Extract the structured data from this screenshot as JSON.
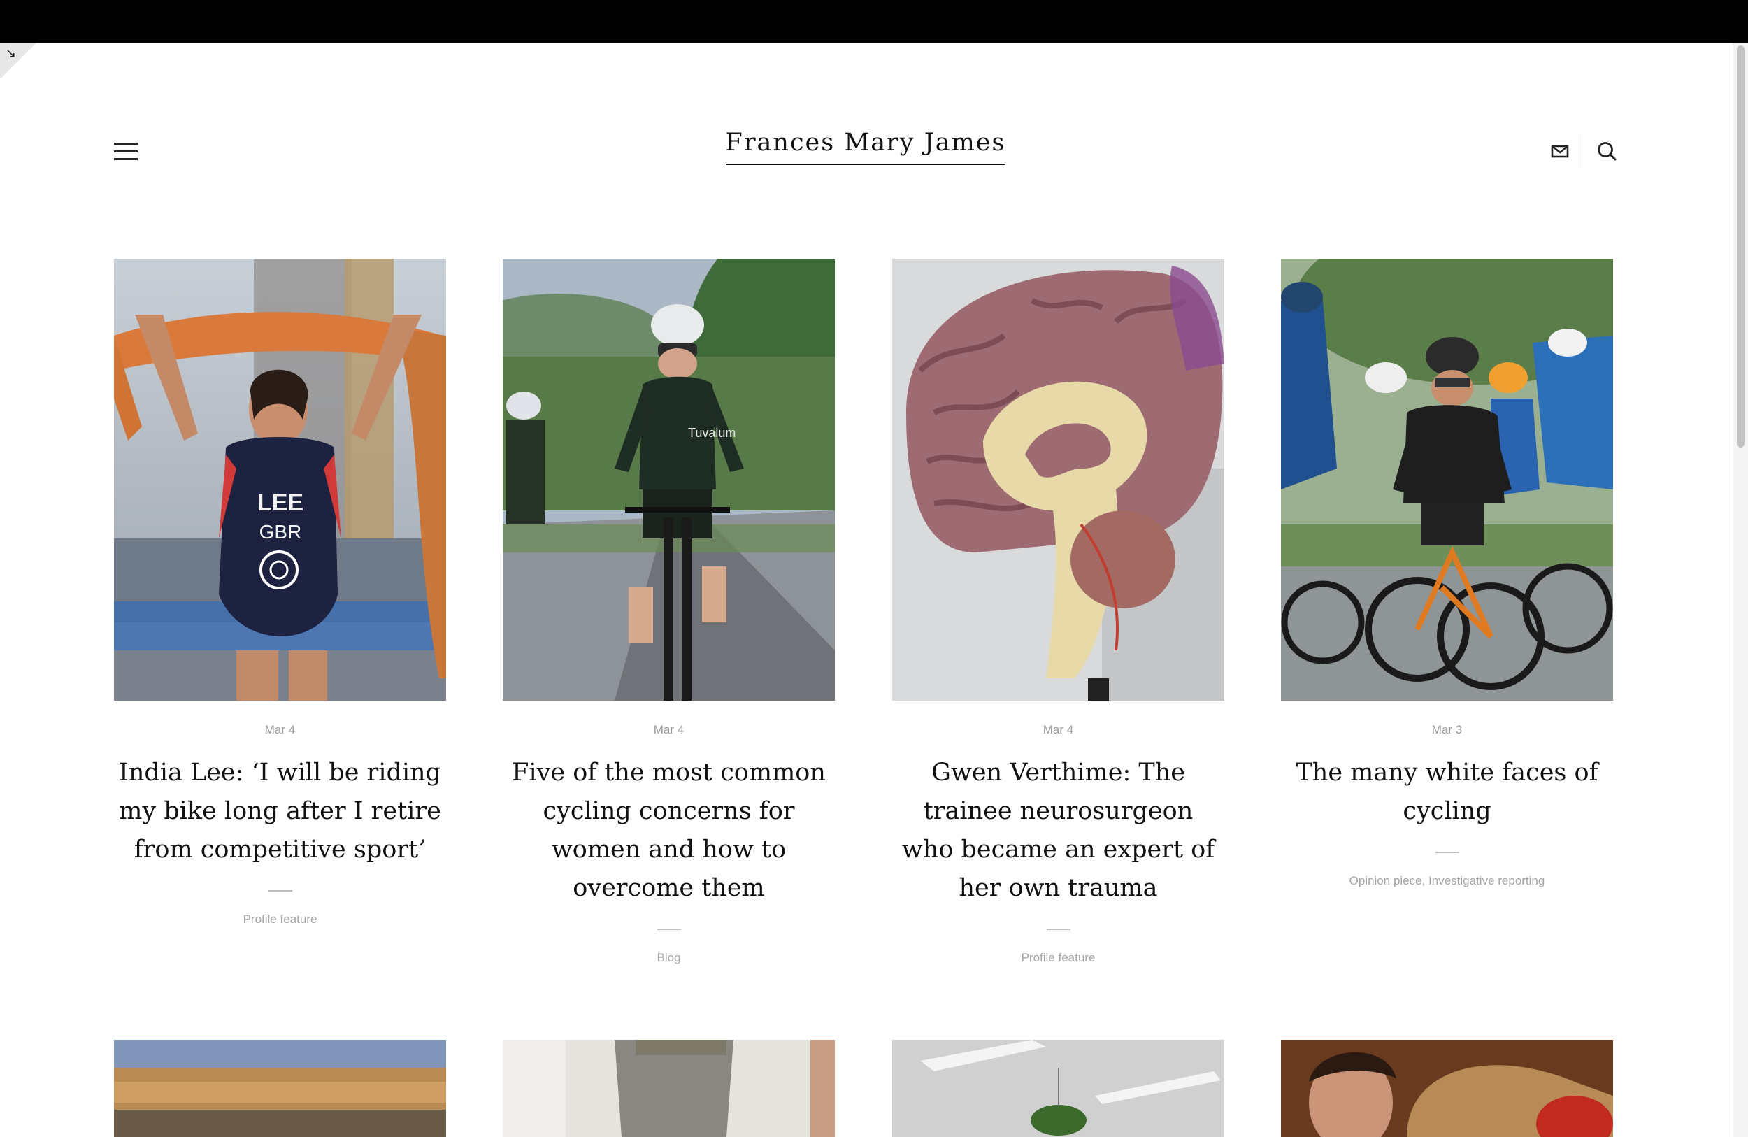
{
  "site": {
    "title": "Frances Mary James"
  },
  "header": {
    "menu_icon": "hamburger-menu-icon",
    "email_icon": "envelope-icon",
    "search_icon": "search-icon"
  },
  "posts": [
    {
      "date": "Mar 4",
      "title": "India Lee: ‘I will be riding my bike long after I retire from competitive sport’",
      "category": "Profile feature",
      "image": "triathlete-finish-line-photo"
    },
    {
      "date": "Mar 4",
      "title": "Five of the most common cycling concerns for women and how to overcome them",
      "category": "Blog",
      "image": "woman-cyclist-photo"
    },
    {
      "date": "Mar 4",
      "title": "Gwen Verthime: The trainee neurosurgeon who became an expert of her own trauma",
      "category": "Profile feature",
      "image": "brain-model-photo"
    },
    {
      "date": "Mar 3",
      "title": "The many white faces of cycling",
      "category": "Opinion piece, Investigative reporting",
      "image": "road-race-peloton-photo"
    }
  ],
  "colors": {
    "topbar": "#000000",
    "meta_text": "#999999",
    "title_text": "#111111"
  }
}
